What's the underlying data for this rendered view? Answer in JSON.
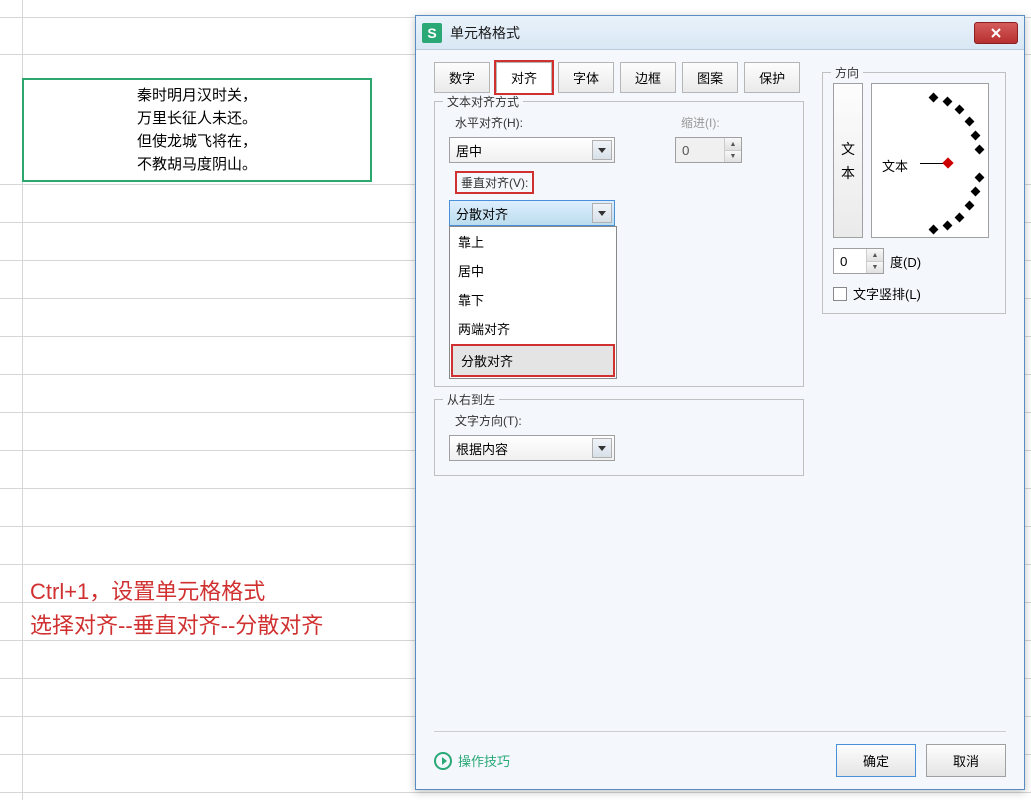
{
  "cell_text": {
    "line1": "秦时明月汉时关，",
    "line2": "万里长征人未还。",
    "line3": "但使龙城飞将在，",
    "line4": "不教胡马度阴山。"
  },
  "instruction": {
    "line1": "Ctrl+1，设置单元格格式",
    "line2": "选择对齐--垂直对齐--分散对齐"
  },
  "dialog": {
    "title": "单元格格式",
    "tabs": [
      "数字",
      "对齐",
      "字体",
      "边框",
      "图案",
      "保护"
    ],
    "group_text_align": "文本对齐方式",
    "halign_label": "水平对齐(H):",
    "halign_value": "居中",
    "indent_label": "缩进(I):",
    "indent_value": "0",
    "valign_label": "垂直对齐(V):",
    "valign_value": "分散对齐",
    "valign_options": [
      "靠上",
      "居中",
      "靠下",
      "两端对齐",
      "分散对齐"
    ],
    "group_rtl": "从右到左",
    "text_dir_label": "文字方向(T):",
    "text_dir_value": "根据内容",
    "group_dir": "方向",
    "vert_btn_ch1": "文",
    "vert_btn_ch2": "本",
    "dial_text": "文本",
    "degree_value": "0",
    "degree_label": "度(D)",
    "vertical_text_label": "文字竖排(L)",
    "tips": "操作技巧",
    "ok": "确定",
    "cancel": "取消"
  }
}
